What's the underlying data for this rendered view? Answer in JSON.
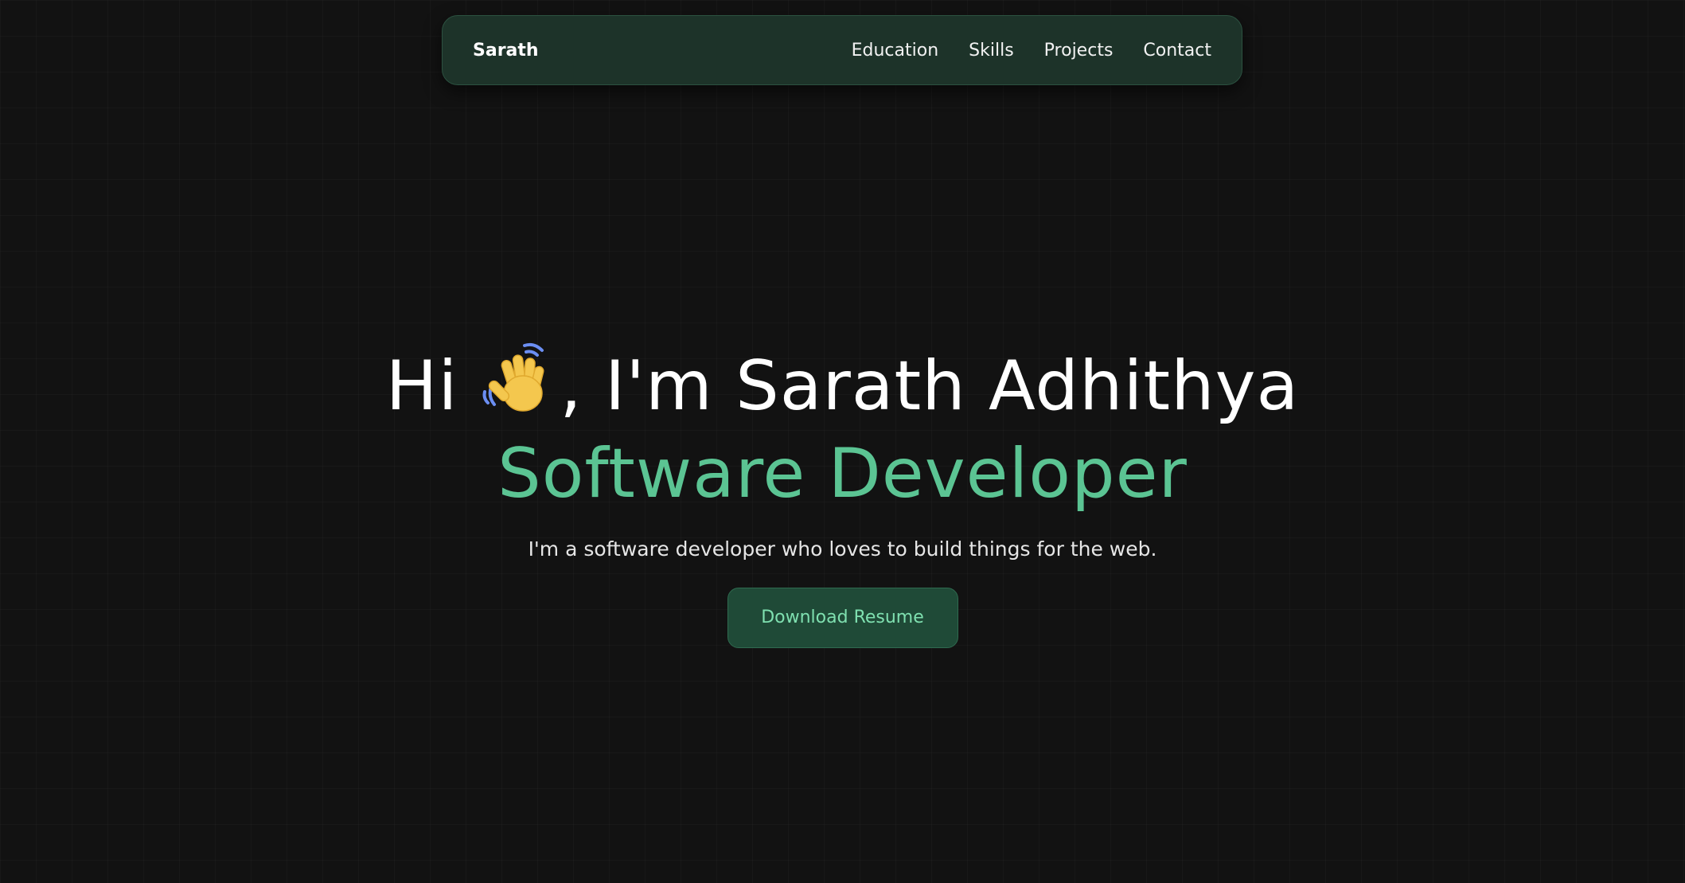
{
  "navbar": {
    "brand": "Sarath",
    "links": [
      {
        "label": "Education"
      },
      {
        "label": "Skills"
      },
      {
        "label": "Projects"
      },
      {
        "label": "Contact"
      }
    ]
  },
  "hero": {
    "greeting_prefix": "Hi",
    "greeting_suffix": ", I'm Sarath Adhithya",
    "wave_icon": "waving-hand-emoji",
    "role": "Software Developer",
    "tagline": "I'm a software developer who loves to build things for the web.",
    "cta_label": "Download Resume"
  },
  "colors": {
    "background": "#121212",
    "navbar_bg": "#1d3329",
    "accent_green": "#5bc493",
    "button_bg": "#1f4a37",
    "button_text": "#7fe0b0"
  }
}
